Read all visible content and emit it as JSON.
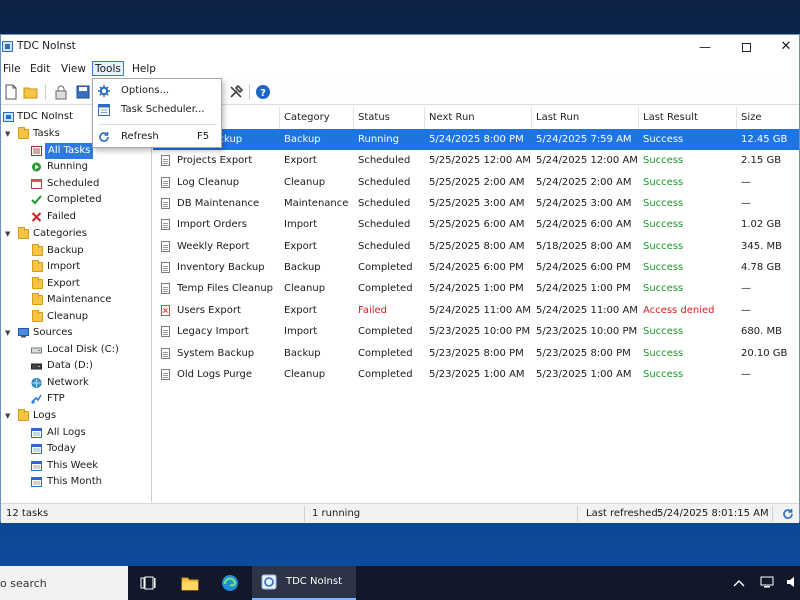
{
  "window": {
    "title": "TDC NoInst"
  },
  "menubar": {
    "items": [
      "File",
      "Edit",
      "View",
      "Tools",
      "Help"
    ]
  },
  "tools_menu": {
    "options": "Options...",
    "scheduler": "Task Scheduler...",
    "refresh": "Refresh",
    "refresh_shortcut": "F5"
  },
  "tree": {
    "root": "TDC NoInst",
    "tasks": {
      "label": "Tasks",
      "children": [
        "All Tasks",
        "Running",
        "Scheduled",
        "Completed",
        "Failed"
      ]
    },
    "categories": {
      "label": "Categories",
      "children": [
        "Backup",
        "Import",
        "Export",
        "Maintenance",
        "Cleanup"
      ]
    },
    "sources": {
      "label": "Sources",
      "children": [
        "Local Disk (C:)",
        "Data (D:)",
        "Network",
        "FTP"
      ]
    },
    "logs": {
      "label": "Logs",
      "children": [
        "All Logs",
        "Today",
        "This Week",
        "This Month"
      ]
    }
  },
  "table": {
    "columns": [
      "Category",
      "Status",
      "Next Run",
      "Last Run",
      "Last Result",
      "Size"
    ],
    "rows": [
      {
        "name": "Daily Backup",
        "category": "Backup",
        "status": "Running",
        "next": "5/24/2025 8:00 PM",
        "last": "5/24/2025 7:59 AM",
        "result": "Success",
        "size": "12.45 GB",
        "icon": "doc"
      },
      {
        "name": "Projects Export",
        "category": "Export",
        "status": "Scheduled",
        "next": "5/25/2025 12:00 AM",
        "last": "5/24/2025 12:00 AM",
        "result": "Success",
        "size": "2.15 GB",
        "icon": "doc"
      },
      {
        "name": "Log Cleanup",
        "category": "Cleanup",
        "status": "Scheduled",
        "next": "5/25/2025 2:00 AM",
        "last": "5/24/2025 2:00 AM",
        "result": "Success",
        "size": "—",
        "icon": "doc"
      },
      {
        "name": "DB Maintenance",
        "category": "Maintenance",
        "status": "Scheduled",
        "next": "5/25/2025 3:00 AM",
        "last": "5/24/2025 3:00 AM",
        "result": "Success",
        "size": "—",
        "icon": "doc"
      },
      {
        "name": "Import Orders",
        "category": "Import",
        "status": "Scheduled",
        "next": "5/25/2025 6:00 AM",
        "last": "5/24/2025 6:00 AM",
        "result": "Success",
        "size": "1.02 GB",
        "icon": "doc"
      },
      {
        "name": "Weekly Report",
        "category": "Export",
        "status": "Scheduled",
        "next": "5/25/2025 8:00 AM",
        "last": "5/18/2025 8:00 AM",
        "result": "Success",
        "size": "345. MB",
        "icon": "doc"
      },
      {
        "name": "Inventory Backup",
        "category": "Backup",
        "status": "Completed",
        "next": "5/24/2025 6:00 PM",
        "last": "5/24/2025 6:00 PM",
        "result": "Success",
        "size": "4.78 GB",
        "icon": "doc"
      },
      {
        "name": "Temp Files Cleanup",
        "category": "Cleanup",
        "status": "Completed",
        "next": "5/24/2025 1:00 PM",
        "last": "5/24/2025 1:00 PM",
        "result": "Success",
        "size": "—",
        "icon": "doc"
      },
      {
        "name": "Users Export",
        "category": "Export",
        "status": "Failed",
        "next": "5/24/2025 11:00 AM",
        "last": "5/24/2025 11:00 AM",
        "result": "Access denied",
        "size": "—",
        "icon": "error"
      },
      {
        "name": "Legacy Import",
        "category": "Import",
        "status": "Completed",
        "next": "5/23/2025 10:00 PM",
        "last": "5/23/2025 10:00 PM",
        "result": "Success",
        "size": "680. MB",
        "icon": "doc"
      },
      {
        "name": "System Backup",
        "category": "Backup",
        "status": "Completed",
        "next": "5/23/2025 8:00 PM",
        "last": "5/23/2025 8:00 PM",
        "result": "Success",
        "size": "20.10 GB",
        "icon": "doc"
      },
      {
        "name": "Old Logs Purge",
        "category": "Cleanup",
        "status": "Completed",
        "next": "5/23/2025 1:00 AM",
        "last": "5/23/2025 1:00 AM",
        "result": "Success",
        "size": "—",
        "icon": "doc"
      }
    ]
  },
  "statusbar": {
    "count": "12 tasks",
    "running": "1 running",
    "refreshed_label": "Last refreshed:",
    "refreshed_value": "5/24/2025 8:01:15 AM"
  },
  "taskbar": {
    "search": "o search",
    "active_app": "TDC NoInst"
  },
  "colors": {
    "accent": "#1e74e0",
    "success": "#1a9a2a",
    "failed": "#d62020"
  }
}
